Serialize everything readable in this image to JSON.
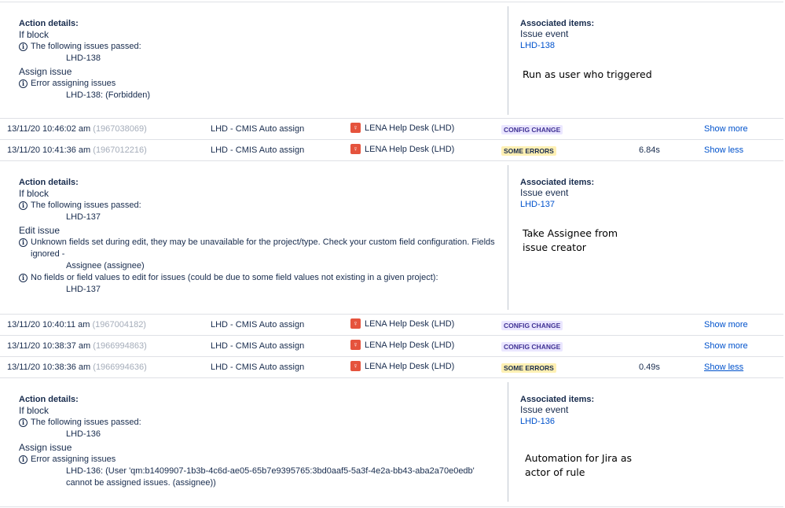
{
  "blocks": [
    {
      "title": "Action details:",
      "lines": [
        {
          "kind": "section",
          "text": "If block"
        },
        {
          "kind": "info",
          "text": "The following issues passed:"
        },
        {
          "kind": "issue",
          "text": "LHD-138"
        },
        {
          "kind": "section",
          "text": "Assign issue"
        },
        {
          "kind": "info",
          "text": "Error assigning issues"
        },
        {
          "kind": "issue",
          "text": "LHD-138: (Forbidden)"
        }
      ],
      "assoc_title": "Associated items:",
      "assoc_event": "Issue event",
      "assoc_link": "LHD-138",
      "note": "Run as user who triggered"
    },
    {
      "title": "Action details:",
      "lines": [
        {
          "kind": "section",
          "text": "If block"
        },
        {
          "kind": "info",
          "text": "The following issues passed:"
        },
        {
          "kind": "issue",
          "text": "LHD-137"
        },
        {
          "kind": "section",
          "text": "Edit issue"
        },
        {
          "kind": "info",
          "text": "Unknown fields set during edit, they may be unavailable for the project/type. Check your custom field configuration. Fields ignored -"
        },
        {
          "kind": "issue",
          "text": "Assignee (assignee)"
        },
        {
          "kind": "info",
          "text": "No fields or field values to edit for issues (could be due to some field values not existing in a given project):"
        },
        {
          "kind": "issue",
          "text": "LHD-137"
        }
      ],
      "assoc_title": "Associated items:",
      "assoc_event": "Issue event",
      "assoc_link": "LHD-137",
      "note": "Take Assignee from\nissue creator"
    },
    {
      "title": "Action details:",
      "lines": [
        {
          "kind": "section",
          "text": "If block"
        },
        {
          "kind": "info",
          "text": "The following issues passed:"
        },
        {
          "kind": "issue",
          "text": "LHD-136"
        },
        {
          "kind": "section",
          "text": "Assign issue"
        },
        {
          "kind": "info",
          "text": "Error assigning issues"
        },
        {
          "kind": "issue",
          "text": "LHD-136: (User 'qm:b1409907-1b3b-4c6d-ae05-65b7e9395765:3bd0aaf5-5a3f-4e2a-bb43-aba2a70e0edb' cannot be assigned issues. (assignee))"
        }
      ],
      "assoc_title": "Associated items:",
      "assoc_event": "Issue event",
      "assoc_link": "LHD-136",
      "note": "Automation for Jira as\nactor of rule"
    }
  ],
  "rows": [
    {
      "timestamp": "13/11/20 10:46:02 am",
      "id": "(1967038069)",
      "rule": "LHD - CMIS Auto assign",
      "project": "LENA Help Desk (LHD)",
      "badge": "CONFIG CHANGE",
      "badge_type": "config",
      "duration": "",
      "toggle": "Show more"
    },
    {
      "timestamp": "13/11/20 10:41:36 am",
      "id": "(1967012216)",
      "rule": "LHD - CMIS Auto assign",
      "project": "LENA Help Desk (LHD)",
      "badge": "SOME ERRORS",
      "badge_type": "errors",
      "duration": "6.84s",
      "toggle": "Show less"
    },
    {
      "timestamp": "13/11/20 10:40:11 am",
      "id": "(1967004182)",
      "rule": "LHD - CMIS Auto assign",
      "project": "LENA Help Desk (LHD)",
      "badge": "CONFIG CHANGE",
      "badge_type": "config",
      "duration": "",
      "toggle": "Show more"
    },
    {
      "timestamp": "13/11/20 10:38:37 am",
      "id": "(1966994863)",
      "rule": "LHD - CMIS Auto assign",
      "project": "LENA Help Desk (LHD)",
      "badge": "CONFIG CHANGE",
      "badge_type": "config",
      "duration": "",
      "toggle": "Show more"
    },
    {
      "timestamp": "13/11/20 10:38:36 am",
      "id": "(1966994636)",
      "rule": "LHD - CMIS Auto assign",
      "project": "LENA Help Desk (LHD)",
      "badge": "SOME ERRORS",
      "badge_type": "errors",
      "duration": "0.49s",
      "toggle": "Show less"
    }
  ],
  "icons": {
    "info": "info-circle-icon",
    "project": "lena-project-icon"
  },
  "colors": {
    "link": "#0052cc",
    "config_badge_bg": "#eae6ff",
    "errors_badge_bg": "#fff0b3"
  }
}
